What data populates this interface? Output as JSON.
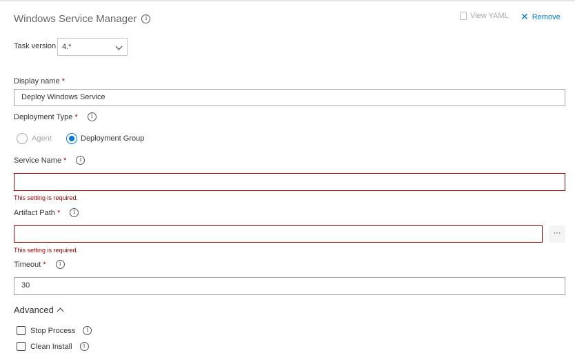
{
  "header": {
    "title": "Windows Service Manager",
    "view_yaml": "View YAML",
    "remove": "Remove"
  },
  "task_version": {
    "label": "Task version",
    "value": "4.*"
  },
  "display_name": {
    "label": "Display name",
    "required": "*",
    "value": "Deploy Windows Service"
  },
  "deployment_type": {
    "label": "Deployment Type",
    "required": "*",
    "options": [
      "Agent",
      "Deployment Group"
    ],
    "selected": "Deployment Group"
  },
  "service_name": {
    "label": "Service Name",
    "required": "*",
    "value": "",
    "error": "This setting is required."
  },
  "artifact_path": {
    "label": "Artifact Path",
    "required": "*",
    "value": "",
    "error": "This setting is required.",
    "browse": "···"
  },
  "timeout": {
    "label": "Timeout",
    "required": "*",
    "value": "30"
  },
  "advanced": {
    "label": "Advanced",
    "options": [
      {
        "label": "Stop Process",
        "checked": false
      },
      {
        "label": "Clean Install",
        "checked": false
      }
    ]
  },
  "colors": {
    "accent": "#0078d4",
    "error": "#a80000"
  }
}
